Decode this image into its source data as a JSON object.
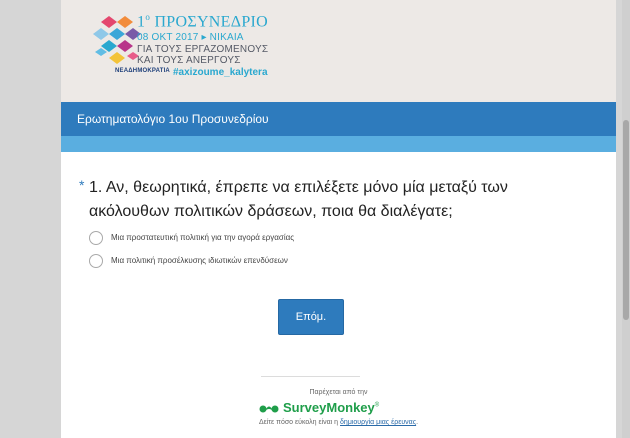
{
  "banner": {
    "title_number": "1",
    "title_sup": "ο",
    "title_text": "ΠΡΟΣΥΝΕΔΡΙΟ",
    "date_line": "08 ΟΚΤ 2017 ▸ ΝΙΚΑΙΑ",
    "sub_line_1": "ΓΙΑ ΤΟΥΣ ΕΡΓΑΖΟΜΕΝΟΥΣ",
    "sub_line_2": "ΚΑΙ ΤΟΥΣ ΑΝΕΡΓΟΥΣ",
    "party": "ΝΕΑΔΗΜΟΚΡΑΤΙΑ",
    "hashtag": "#axizoume_kalytera"
  },
  "survey": {
    "title": "Ερωτηματολόγιο 1ου Προσυνεδρίου"
  },
  "question": {
    "required_marker": "*",
    "text": "1. Αν, θεωρητικά, έπρεπε να επιλέξετε μόνο μία μεταξύ των ακόλουθων πολιτικών δράσεων, ποια θα διαλέγατε;",
    "options": [
      {
        "label": "Μια προστατευτική πολιτική για την αγορά εργασίας"
      },
      {
        "label": "Μια πολιτική προσέλκυσης ιδιωτικών επενδύσεων"
      }
    ]
  },
  "buttons": {
    "next_label": "Επόμ."
  },
  "footer": {
    "powered_by": "Παρέχεται από την",
    "brand": "SurveyMonkey",
    "brand_mark": "®",
    "cta_prefix": "Δείτε πόσο εύκολη είναι η ",
    "cta_link": "δημιουργία μιας έρευνας",
    "cta_suffix": "."
  },
  "colors": {
    "title_bar": "#2e7bbd",
    "progress_bar": "#5aaee0",
    "brand_green": "#1f9e4a",
    "accent_cyan": "#2aa8cf"
  }
}
